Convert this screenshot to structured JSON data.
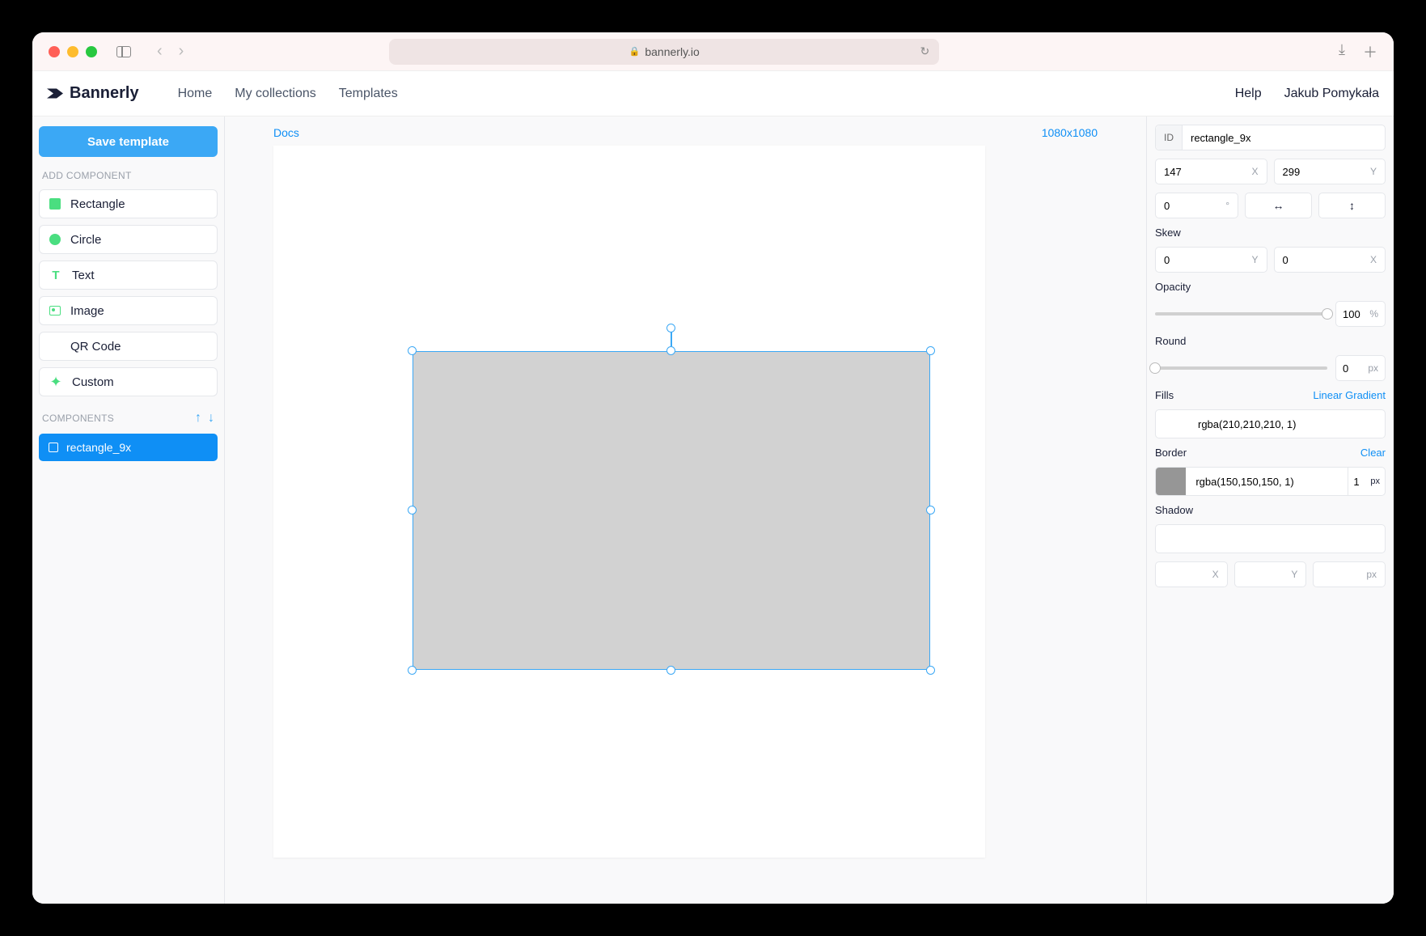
{
  "browser": {
    "url_host": "bannerly.io"
  },
  "header": {
    "brand": "Bannerly",
    "nav": [
      "Home",
      "My collections",
      "Templates"
    ],
    "help": "Help",
    "user": "Jakub Pomykała"
  },
  "sidebar": {
    "save_btn": "Save template",
    "add_component_label": "ADD COMPONENT",
    "component_types": [
      {
        "label": "Rectangle",
        "icon": "rect"
      },
      {
        "label": "Circle",
        "icon": "circle"
      },
      {
        "label": "Text",
        "icon": "text"
      },
      {
        "label": "Image",
        "icon": "image"
      },
      {
        "label": "QR Code",
        "icon": "qr"
      },
      {
        "label": "Custom",
        "icon": "custom"
      }
    ],
    "components_label": "COMPONENTS",
    "components": [
      {
        "name": "rectangle_9x"
      }
    ]
  },
  "canvas": {
    "docs_label": "Docs",
    "dimensions": "1080x1080"
  },
  "props": {
    "id_label": "ID",
    "id_value": "rectangle_9x",
    "x_value": "147",
    "y_value": "299",
    "rotation": "0",
    "skew_label": "Skew",
    "skew_x": "0",
    "skew_y": "0",
    "opacity_label": "Opacity",
    "opacity_value": "100",
    "round_label": "Round",
    "round_value": "0",
    "fills_label": "Fills",
    "gradient_link": "Linear Gradient",
    "fill_color": "rgba(210,210,210, 1)",
    "fill_hex": "#d2d2d2",
    "border_label": "Border",
    "clear_link": "Clear",
    "border_color": "rgba(150,150,150, 1)",
    "border_hex": "#969696",
    "border_width": "1",
    "shadow_label": "Shadow",
    "shadow_x": "",
    "shadow_y": "",
    "shadow_px": ""
  },
  "suffixes": {
    "x": "X",
    "y": "Y",
    "deg": "°",
    "pct": "%",
    "px": "px"
  }
}
